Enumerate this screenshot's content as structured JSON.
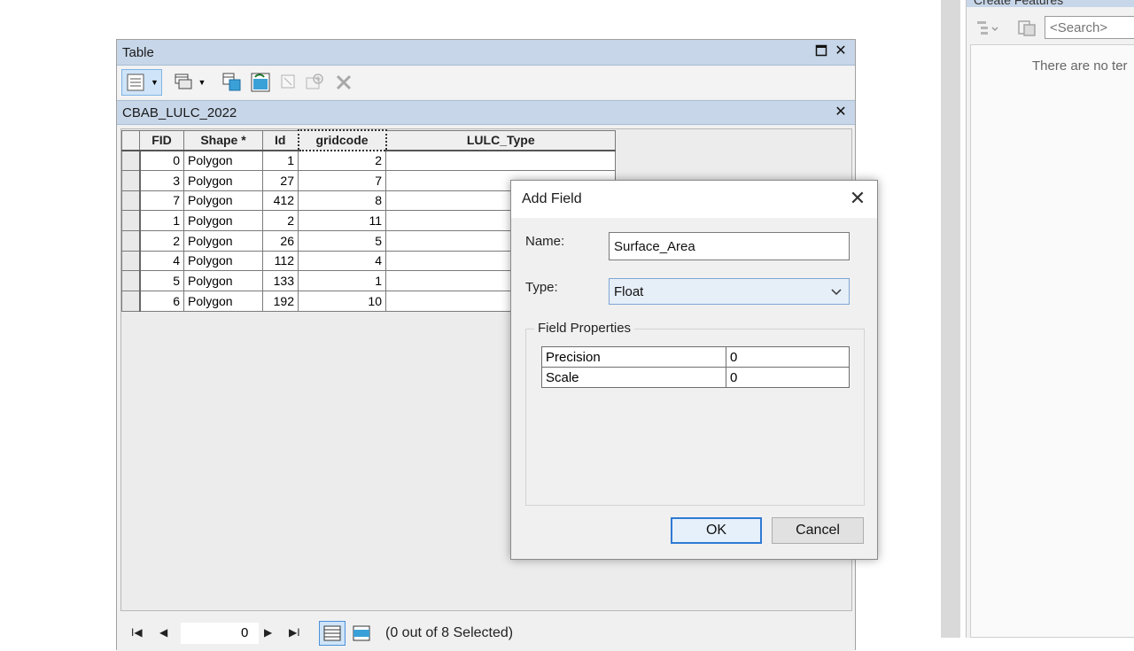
{
  "table_window": {
    "title": "Table",
    "layer_name": "CBAB_LULC_2022",
    "columns": [
      "FID",
      "Shape *",
      "Id",
      "gridcode",
      "LULC_Type"
    ],
    "rows": [
      {
        "fid": "0",
        "shape": "Polygon",
        "id": "1",
        "gridcode": "2",
        "lulc": ""
      },
      {
        "fid": "3",
        "shape": "Polygon",
        "id": "27",
        "gridcode": "7",
        "lulc": ""
      },
      {
        "fid": "7",
        "shape": "Polygon",
        "id": "412",
        "gridcode": "8",
        "lulc": ""
      },
      {
        "fid": "1",
        "shape": "Polygon",
        "id": "2",
        "gridcode": "11",
        "lulc": ""
      },
      {
        "fid": "2",
        "shape": "Polygon",
        "id": "26",
        "gridcode": "5",
        "lulc": ""
      },
      {
        "fid": "4",
        "shape": "Polygon",
        "id": "112",
        "gridcode": "4",
        "lulc": ""
      },
      {
        "fid": "5",
        "shape": "Polygon",
        "id": "133",
        "gridcode": "1",
        "lulc": ""
      },
      {
        "fid": "6",
        "shape": "Polygon",
        "id": "192",
        "gridcode": "10",
        "lulc": ""
      }
    ],
    "status": {
      "record_number": "0",
      "selection_text": "(0 out of 8 Selected)"
    },
    "icons": [
      "table-options-icon",
      "related-tables-icon",
      "select-by-attributes-icon",
      "switch-selection-icon",
      "clear-selection-icon",
      "zoom-to-selected-icon",
      "delete-selected-icon"
    ]
  },
  "right_pane": {
    "header": "Create Features",
    "search_placeholder": "<Search>",
    "empty_message": "There are no ter"
  },
  "add_field_dialog": {
    "title": "Add Field",
    "name_label": "Name:",
    "name_value": "Surface_Area",
    "type_label": "Type:",
    "type_value": "Float",
    "group_label": "Field Properties",
    "properties": [
      {
        "key": "Precision",
        "value": "0"
      },
      {
        "key": "Scale",
        "value": "0"
      }
    ],
    "ok_label": "OK",
    "cancel_label": "Cancel"
  }
}
